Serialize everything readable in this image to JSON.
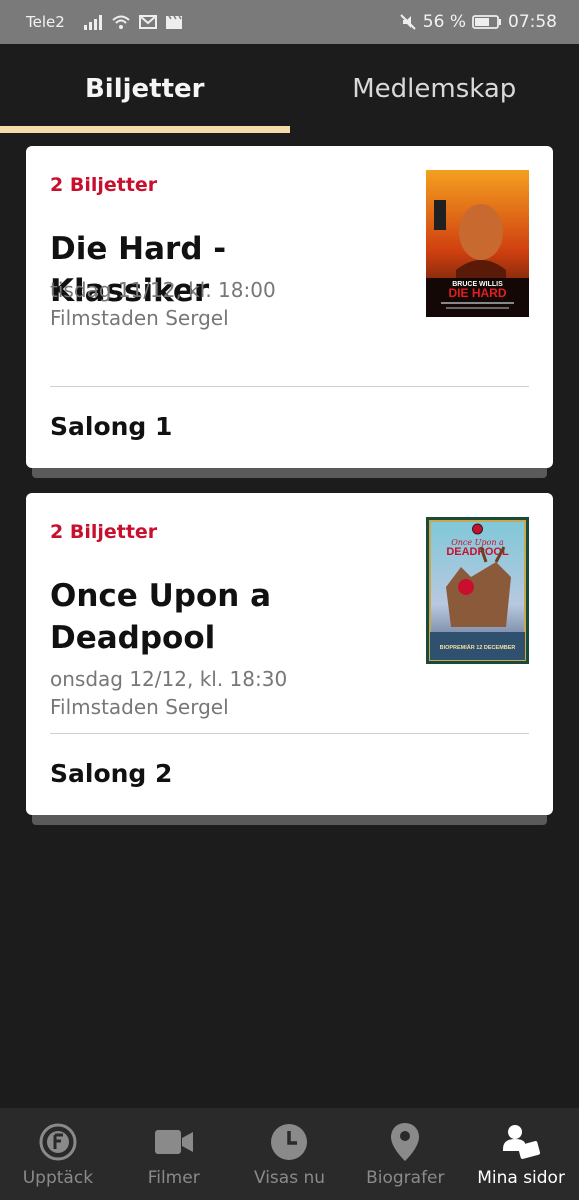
{
  "status_bar": {
    "carrier": "Tele2",
    "battery_percent": "56 %",
    "time": "07:58"
  },
  "tabs": [
    {
      "label": "Biljetter",
      "active": true
    },
    {
      "label": "Medlemskap",
      "active": false
    }
  ],
  "tickets": [
    {
      "count": "2 Biljetter",
      "title": "Die Hard - Klassiker",
      "date": "tisdag 11/12, kl. 18:00",
      "cinema": "Filmstaden Sergel",
      "salong": "Salong 1",
      "poster": {
        "actor": "BRUCE WILLIS",
        "title": "DIE HARD"
      }
    },
    {
      "count": "2 Biljetter",
      "title": "Once Upon a Deadpool",
      "date": "onsdag 12/12, kl. 18:30",
      "cinema": "Filmstaden Sergel",
      "salong": "Salong 2",
      "poster": {
        "top": "Once Upon a",
        "title": "DEADPOOL",
        "footer": "BIOPREMIÄR 12 DECEMBER"
      }
    }
  ],
  "bottom_nav": [
    {
      "label": "Upptäck",
      "icon": "f-circle-icon",
      "active": false
    },
    {
      "label": "Filmer",
      "icon": "video-camera-icon",
      "active": false
    },
    {
      "label": "Visas nu",
      "icon": "clock-icon",
      "active": false
    },
    {
      "label": "Biografer",
      "icon": "location-pin-icon",
      "active": false
    },
    {
      "label": "Mina sidor",
      "icon": "user-ticket-icon",
      "active": true
    }
  ],
  "colors": {
    "background": "#1c1c1c",
    "accent_red": "#c8102e",
    "tab_indicator": "#f6dca8"
  }
}
